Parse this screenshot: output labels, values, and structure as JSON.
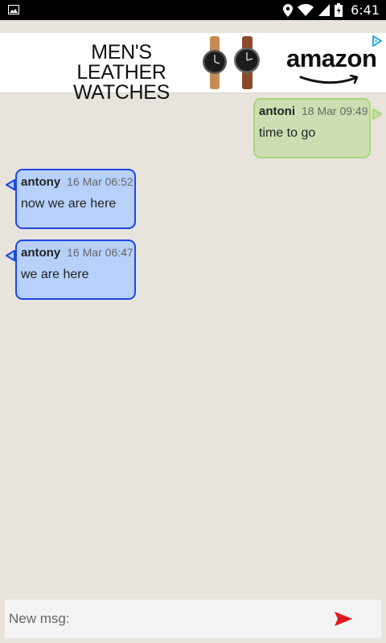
{
  "status_bar": {
    "time": "6:41",
    "icons": [
      "image-notification-icon",
      "location-icon",
      "wifi-icon",
      "signal-icon",
      "battery-icon"
    ]
  },
  "ad": {
    "headline": "MEN'S LEATHER WATCHES",
    "brand": "amazon",
    "icons": [
      "watches-image",
      "amazon-smile-logo",
      "adchoices-icon"
    ]
  },
  "messages": [
    {
      "direction": "outgoing",
      "sender": "antoni",
      "time": "18 Mar 09:49",
      "text": "time to go"
    },
    {
      "direction": "incoming",
      "sender": "antony",
      "time": "16 Mar 06:52",
      "text": "now we are here"
    },
    {
      "direction": "incoming",
      "sender": "antony",
      "time": "16 Mar 06:47",
      "text": "we are here"
    }
  ],
  "composer": {
    "placeholder": "New msg:",
    "value": "",
    "send_icon": "send-icon"
  },
  "colors": {
    "background": "#e8e3dd",
    "outgoing_fill": "#cddfb2",
    "outgoing_border": "#a8d778",
    "incoming_fill": "#b7d1fb",
    "incoming_border": "#1f46e4",
    "send": "#e8191f"
  }
}
